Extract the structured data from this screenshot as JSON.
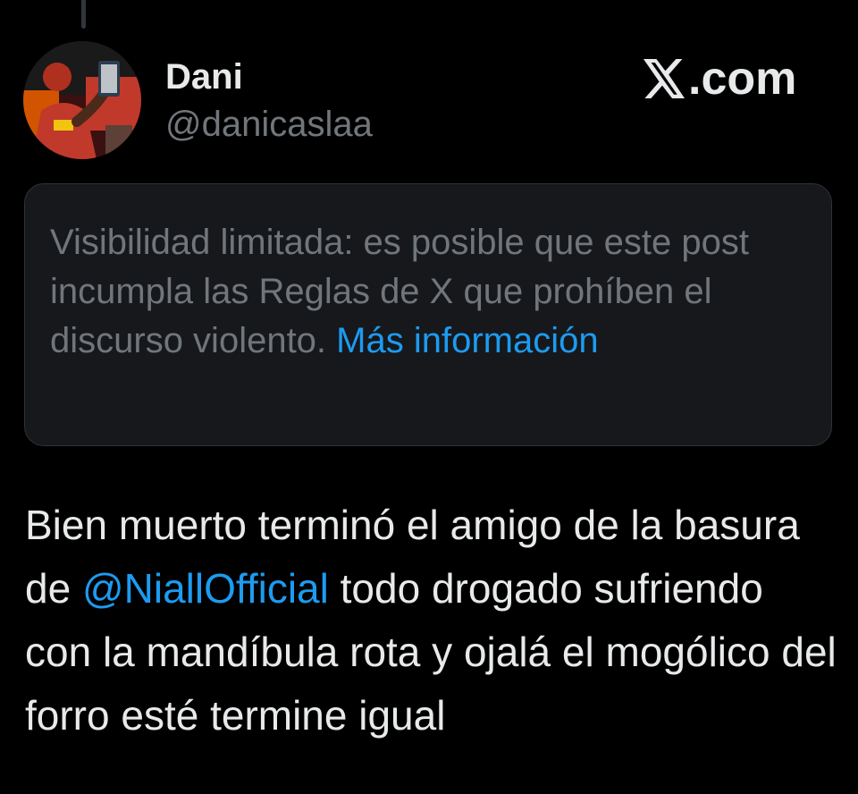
{
  "author": {
    "display_name": "Dani",
    "handle": "@danicaslaa",
    "avatar": "profile-photo"
  },
  "brand": {
    "label": ".com",
    "icon": "x-logo-icon"
  },
  "notice": {
    "text": "Visibilidad limitada: es posible que este post incumpla las Reglas de X que prohíben el discurso violento.",
    "link_label": "Más información"
  },
  "tweet": {
    "text_before": "Bien muerto terminó el amigo de la basura de ",
    "mention": "@NiallOfficial",
    "text_after": " todo drogado sufriendo con la mandíbula rota y ojalá el mogólico del forro esté termine igual"
  },
  "colors": {
    "background": "#000000",
    "text_primary": "#e7e9ea",
    "text_secondary": "#71767b",
    "link": "#1d9bf0",
    "notice_background": "#16181c"
  }
}
